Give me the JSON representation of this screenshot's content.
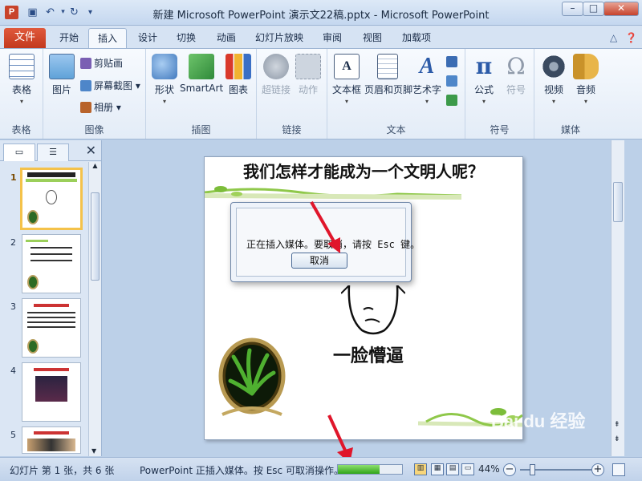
{
  "window": {
    "app_icon_letter": "P",
    "title": "新建 Microsoft PowerPoint 演示文22稿.pptx - Microsoft PowerPoint"
  },
  "tabs": {
    "file": "文件",
    "items": [
      "开始",
      "插入",
      "设计",
      "切换",
      "动画",
      "幻灯片放映",
      "审阅",
      "视图",
      "加载项"
    ],
    "active": "插入"
  },
  "ribbon": {
    "groups": {
      "table": "表格",
      "images": "图像",
      "illustrations": "插图",
      "links": "链接",
      "text": "文本",
      "symbols": "符号",
      "media": "媒体"
    },
    "buttons": {
      "table": "表格",
      "picture": "图片",
      "clipart": "剪贴画",
      "screenshot": "屏幕截图",
      "album": "相册",
      "shapes": "形状",
      "smartart": "SmartArt",
      "chart": "图表",
      "hyperlink": "超链接",
      "action": "动作",
      "textbox": "文本框",
      "header_footer": "页眉和页脚",
      "wordart": "艺术字",
      "equation": "公式",
      "symbol": "符号",
      "video": "视频",
      "audio": "音频"
    }
  },
  "slides_pane": {
    "numbers": [
      "1",
      "2",
      "3",
      "4",
      "5"
    ],
    "active": "1"
  },
  "slide": {
    "title": "我们怎样才能成为一个文明人呢？",
    "caption": "一脸懵逼"
  },
  "dialog": {
    "message": "正在插入媒体。要取消，请按 Esc 键。",
    "cancel": "取消"
  },
  "statusbar": {
    "slide_info": "幻灯片 第 1 张，共 6 张",
    "message": "PowerPoint 正插入媒体。按 Esc 可取消操作。",
    "progress": 0.65,
    "zoom": "44%"
  },
  "watermark": "Bai du 经验",
  "colors": {
    "file_tab": "#c3391e",
    "accent_arrow": "#e0162b",
    "progress": "#2fa418"
  }
}
